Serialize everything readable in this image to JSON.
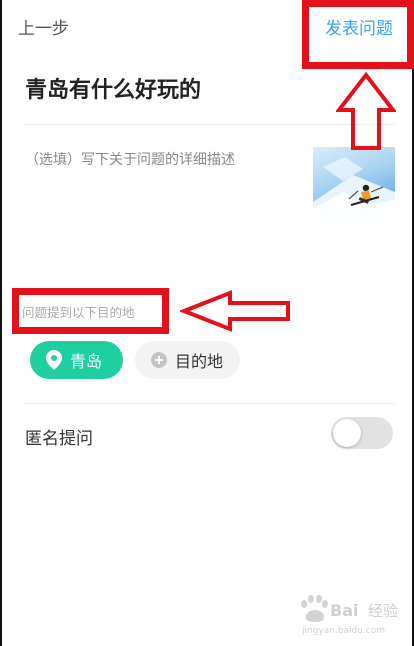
{
  "header": {
    "back_label": "上一步",
    "submit_label": "发表问题"
  },
  "question": {
    "title": "青岛有什么好玩的",
    "description_placeholder": "（选填）写下关于问题的详细描述"
  },
  "destinations": {
    "hint": "问题提到以下目的地",
    "tags": [
      {
        "label": "青岛",
        "icon": "location-pin-icon",
        "selected": true
      },
      {
        "label": "目的地",
        "icon": "plus-circle-icon",
        "selected": false
      }
    ]
  },
  "anonymous": {
    "label": "匿名提问",
    "enabled": false
  },
  "annotation_color": "#e4101c",
  "accent_color": "#1fcf9f",
  "link_color": "#3aa3f0",
  "watermark": {
    "brand": "Baidu经验",
    "url": "jingyan.baidu.com"
  }
}
